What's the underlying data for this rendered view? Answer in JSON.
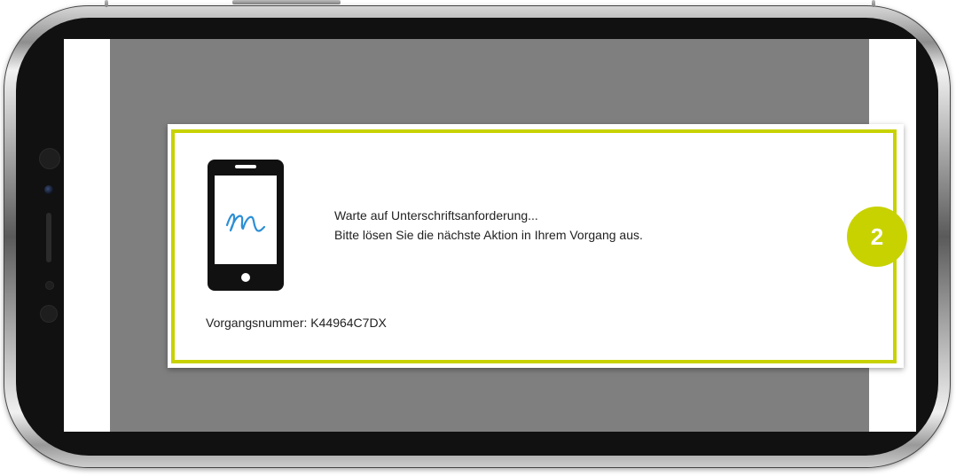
{
  "dialog": {
    "status_line": "Warte auf Unterschriftsanforderung...",
    "instruction_line": "Bitte lösen Sie die nächste Aktion in Ihrem Vorgang aus.",
    "case_number_label": "Vorgangsnummer: K44964C7DX",
    "device_icon": "smartphone-signature-icon"
  },
  "step_badge": {
    "number": "2"
  },
  "colors": {
    "accent": "#c8d200",
    "overlay": "#7f7f7f",
    "text": "#222222",
    "icon_blue": "#2d8fd5"
  }
}
